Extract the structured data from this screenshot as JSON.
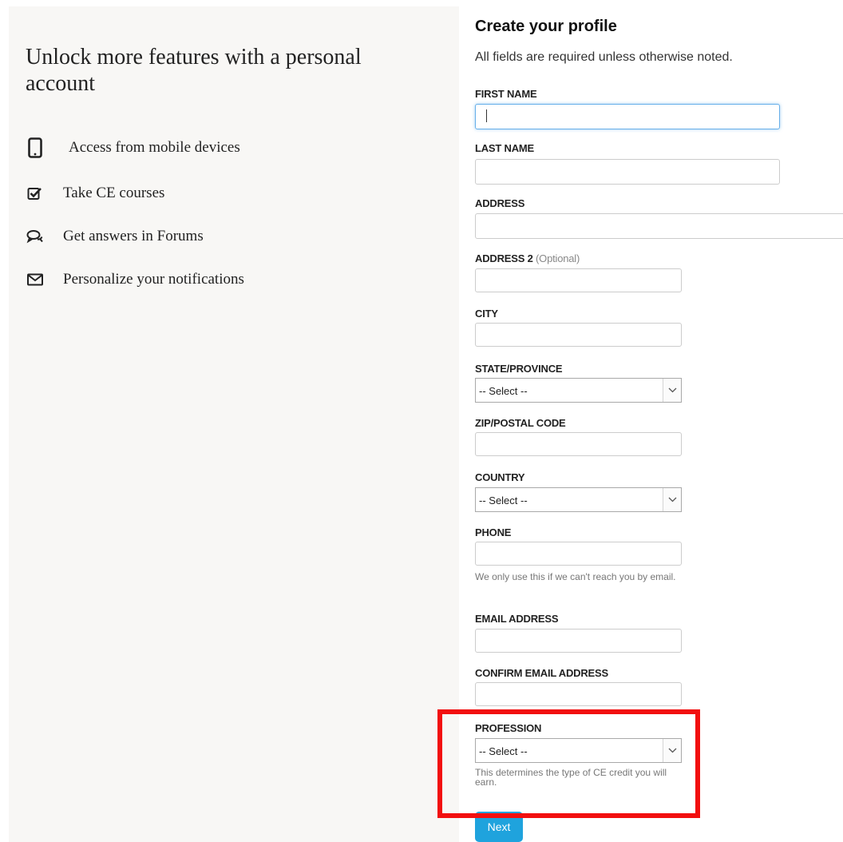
{
  "promo": {
    "title": "Unlock more features with a personal account",
    "features": [
      {
        "icon": "mobile-phone-icon",
        "label": "Access from mobile devices"
      },
      {
        "icon": "checkbox-check-icon",
        "label": "Take CE courses"
      },
      {
        "icon": "chat-bubbles-icon",
        "label": "Get answers in Forums"
      },
      {
        "icon": "envelope-icon",
        "label": "Personalize your notifications"
      }
    ]
  },
  "form": {
    "title": "Create your profile",
    "subtitle": "All fields are required unless otherwise noted.",
    "first_name": {
      "label": "FIRST NAME",
      "value": ""
    },
    "last_name": {
      "label": "LAST NAME",
      "value": ""
    },
    "address": {
      "label": "ADDRESS",
      "value": ""
    },
    "address2": {
      "label": "ADDRESS 2",
      "optional": "(Optional)",
      "value": ""
    },
    "city": {
      "label": "CITY",
      "value": ""
    },
    "state": {
      "label": "STATE/PROVINCE",
      "selected": "-- Select --"
    },
    "zip": {
      "label": "ZIP/POSTAL CODE",
      "value": ""
    },
    "country": {
      "label": "COUNTRY",
      "selected": "-- Select --"
    },
    "phone": {
      "label": "PHONE",
      "value": "",
      "help": "We only use this if we can't reach you by email."
    },
    "email": {
      "label": "EMAIL ADDRESS",
      "value": ""
    },
    "confirm_email": {
      "label": "CONFIRM EMAIL ADDRESS",
      "value": ""
    },
    "profession": {
      "label": "PROFESSION",
      "selected": "-- Select --",
      "help": "This determines the type of CE credit you will earn."
    },
    "next_label": "Next"
  },
  "colors": {
    "panel_bg": "#f8f7f5",
    "accent": "#1fa3dd",
    "highlight": "#f20f0f",
    "focus": "#66afe9"
  }
}
